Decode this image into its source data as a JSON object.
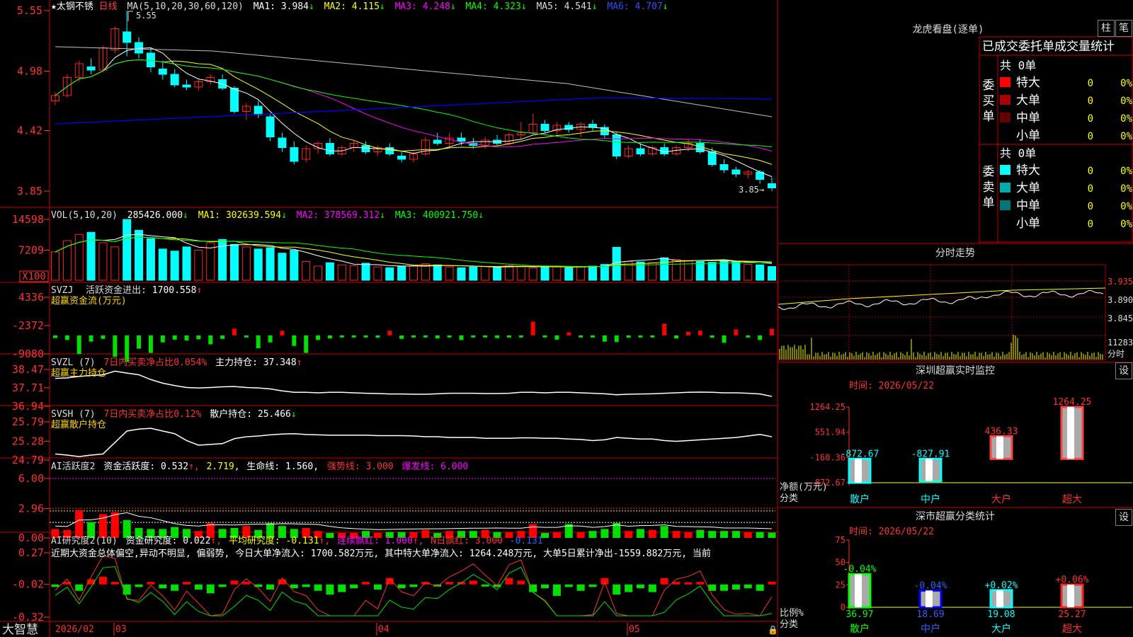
{
  "stock": {
    "name": "★太钢不锈",
    "period": "日线"
  },
  "colors": {
    "up": "#ff2020",
    "down": "#00ffff",
    "ma1": "#ffffff",
    "ma2": "#ffff00",
    "ma3": "#ff00ff",
    "ma4": "#00ff00",
    "ma5": "#c0c0c0",
    "ma6": "#0000ff",
    "grid": "#aa0000",
    "axis": "#ff3030"
  },
  "price_panel": {
    "params": "MA(5,10,20,30,60,120)",
    "ma": [
      {
        "label": "MA1: 3.984",
        "arrow": "↓"
      },
      {
        "label": "MA2: 4.115",
        "arrow": "↓"
      },
      {
        "label": "MA3: 4.248",
        "arrow": "↓"
      },
      {
        "label": "MA4: 4.323",
        "arrow": "↓"
      },
      {
        "label": "MA5: 4.541",
        "arrow": "↓"
      },
      {
        "label": "MA6: 4.707",
        "arrow": "↓"
      }
    ],
    "ticks": [
      "5.55",
      "4.98",
      "4.42",
      "3.85"
    ],
    "high_label": "5.55",
    "low_label": "3.85→"
  },
  "vol_panel": {
    "title": "VOL(5,10,20)",
    "value": "285426.000",
    "value_arrow": "↓",
    "ma": [
      {
        "label": "MA1: 302639.594",
        "arrow": "↓"
      },
      {
        "label": "MA2: 378569.312",
        "arrow": "↓"
      },
      {
        "label": "MA3: 400921.750",
        "arrow": "↓"
      }
    ],
    "ticks": [
      "14598",
      "7209"
    ],
    "unit": "X100"
  },
  "svzj_panel": {
    "title": "SVZJ",
    "label": "活跃资金进出:",
    "value": "1700.558",
    "arrow": "↑",
    "subtitle": "超赢资金流(万元)",
    "ticks": [
      "4336",
      "-2372",
      "-9080"
    ]
  },
  "svzl_panel": {
    "title": "SVZL (7)",
    "label1": "7日内买卖净占比0.054%",
    "label2": "主力持仓: 37.348",
    "arrow": "↑",
    "subtitle": "超赢主力持仓",
    "ticks": [
      "38.47",
      "37.71",
      "36.94"
    ]
  },
  "svsh_panel": {
    "title": "SVSH (7)",
    "label1": "7日内买卖净占比0.12%",
    "label2": "散户持仓: 25.466",
    "arrow": "↓",
    "subtitle": "超赢散户持仓",
    "ticks": [
      "25.79",
      "25.28",
      "24.79"
    ]
  },
  "ai1_panel": {
    "title": "AI活跃度2",
    "l1": "资金活跃度: 0.532",
    "l2": "2.719",
    "l3": "生命线: 1.560",
    "l4": "强势线: 3.000",
    "l5": "爆发线: 6.000",
    "ticks": [
      "6.00",
      "2.96",
      "0.00"
    ]
  },
  "ai2_panel": {
    "title": "AI研究度2(10)",
    "l1": "资金研究度: 0.022",
    "l2": "平均研究度: -0.131",
    "l3": "连续飘红: 1.000",
    "l4": "N日飘红: 3.000",
    "l5": "-0.131",
    "text": "近期大资金总体偏空,异动不明显, 偏弱势, 今日大单净流入: 1700.582万元, 其中特大单净流入: 1264.248万元, 大单5日累计净出-1559.882万元, 当前",
    "ticks": [
      "0.27",
      "-0.02",
      "-0.32"
    ]
  },
  "bottom": {
    "brand": "大智慧",
    "dates": [
      "2026/02",
      "03",
      "04",
      "05"
    ]
  },
  "right": {
    "lhb_title": "龙虎看盘(逐单)",
    "btn_zhu": "柱",
    "btn_bi": "笔",
    "stat_title": "已成交委托单成交量统计",
    "buy": {
      "label": "委买单",
      "count": "共 0单",
      "rows": [
        {
          "name": "特大",
          "v": "0",
          "p": "0%",
          "c": "#ff0000"
        },
        {
          "name": "大单",
          "v": "0",
          "p": "0%",
          "c": "#aa0000"
        },
        {
          "name": "中单",
          "v": "0",
          "p": "0%",
          "c": "#660000"
        },
        {
          "name": "小单",
          "v": "0",
          "p": "0%",
          "c": ""
        }
      ]
    },
    "sell": {
      "label": "委卖单",
      "count": "共 0单",
      "rows": [
        {
          "name": "特大",
          "v": "0",
          "p": "0%",
          "c": "#00ffff"
        },
        {
          "name": "大单",
          "v": "0",
          "p": "0%",
          "c": "#00aaaa"
        },
        {
          "name": "中单",
          "v": "0",
          "p": "0%",
          "c": "#007777"
        },
        {
          "name": "小单",
          "v": "0",
          "p": "0%",
          "c": ""
        }
      ]
    },
    "fs_title": "分时走势",
    "fs_ticks": [
      "3.935",
      "3.890",
      "3.845"
    ],
    "fs_vol_ticks": [
      "11283",
      "分时"
    ],
    "sz_title": "深圳超赢实时监控",
    "sz_time": "时间: 2026/05/22",
    "btn_set": "设",
    "sz_ticks": [
      "1264.25",
      "551.94",
      "-160.36",
      "-872.67"
    ],
    "sz_axis_label1": "净额(万元)",
    "sz_axis_label2": "分类",
    "sz_bars": [
      {
        "cat": "散户",
        "value": -872.67,
        "label": "-872.67"
      },
      {
        "cat": "中户",
        "value": -827.91,
        "label": "-827.91"
      },
      {
        "cat": "大户",
        "value": 436.33,
        "label": "436.33"
      },
      {
        "cat": "超大",
        "value": 1264.25,
        "label": "1264.25"
      }
    ],
    "cls_title": "深市超赢分类统计",
    "cls_time": "时间: 2026/05/22",
    "cls_ticks": [
      "75",
      "50",
      "25",
      "0"
    ],
    "cls_axis_label1": "比例%",
    "cls_axis_label2": "分类",
    "cls_bars": [
      {
        "cat": "散户",
        "value": 36.97,
        "label": "36.97",
        "chg": "-0.04%"
      },
      {
        "cat": "中户",
        "value": 18.69,
        "label": "18.69",
        "chg": "-0.04%"
      },
      {
        "cat": "大户",
        "value": 19.08,
        "label": "19.08",
        "chg": "+0.02%"
      },
      {
        "cat": "超大",
        "value": 25.27,
        "label": "25.27",
        "chg": "+0.06%"
      }
    ]
  },
  "chart_data": [
    {
      "type": "candlestick",
      "title": "★太钢不锈 日线",
      "ylim": [
        3.85,
        5.55
      ],
      "x": [
        "2026-02-23",
        "2026-02-24",
        "2026-02-25",
        "2026-02-26",
        "2026-02-27",
        "2026-03-02",
        "2026-03-03",
        "2026-03-04",
        "2026-03-05",
        "2026-03-06",
        "2026-03-09",
        "2026-03-10",
        "2026-03-11",
        "2026-03-12",
        "2026-03-13",
        "2026-03-16",
        "2026-03-17",
        "2026-03-18",
        "2026-03-19",
        "2026-03-20",
        "2026-03-23",
        "2026-03-24",
        "2026-03-25",
        "2026-03-26",
        "2026-03-27",
        "2026-03-30",
        "2026-03-31",
        "2026-04-01",
        "2026-04-02",
        "2026-04-03",
        "2026-04-07",
        "2026-04-08",
        "2026-04-09",
        "2026-04-10",
        "2026-04-13",
        "2026-04-14",
        "2026-04-15",
        "2026-04-16",
        "2026-04-17",
        "2026-04-20",
        "2026-04-21",
        "2026-04-22",
        "2026-04-23",
        "2026-04-24",
        "2026-04-27",
        "2026-04-28",
        "2026-04-29",
        "2026-04-30",
        "2026-05-06",
        "2026-05-07",
        "2026-05-08",
        "2026-05-11",
        "2026-05-12",
        "2026-05-13",
        "2026-05-14",
        "2026-05-15",
        "2026-05-18",
        "2026-05-19",
        "2026-05-20",
        "2026-05-21",
        "2026-05-22"
      ],
      "ohlc": [
        [
          4.7,
          4.78,
          4.66,
          4.75
        ],
        [
          4.75,
          4.95,
          4.73,
          4.92
        ],
        [
          4.92,
          5.08,
          4.88,
          5.05
        ],
        [
          5.02,
          5.1,
          4.95,
          4.99
        ],
        [
          4.99,
          5.22,
          4.97,
          5.2
        ],
        [
          5.18,
          5.4,
          5.15,
          5.38
        ],
        [
          5.35,
          5.55,
          5.12,
          5.25
        ],
        [
          5.25,
          5.3,
          5.1,
          5.15
        ],
        [
          5.15,
          5.2,
          4.97,
          5.02
        ],
        [
          5.0,
          5.08,
          4.9,
          4.95
        ],
        [
          4.95,
          5.0,
          4.83,
          4.85
        ],
        [
          4.85,
          4.9,
          4.8,
          4.83
        ],
        [
          4.83,
          4.9,
          4.8,
          4.88
        ],
        [
          4.88,
          4.95,
          4.85,
          4.92
        ],
        [
          4.9,
          4.95,
          4.8,
          4.82
        ],
        [
          4.82,
          4.84,
          4.58,
          4.6
        ],
        [
          4.6,
          4.68,
          4.52,
          4.65
        ],
        [
          4.65,
          4.7,
          4.54,
          4.57
        ],
        [
          4.55,
          4.58,
          4.32,
          4.36
        ],
        [
          4.35,
          4.4,
          4.22,
          4.26
        ],
        [
          4.26,
          4.32,
          4.1,
          4.13
        ],
        [
          4.15,
          4.28,
          4.12,
          4.25
        ],
        [
          4.25,
          4.32,
          4.2,
          4.3
        ],
        [
          4.3,
          4.35,
          4.18,
          4.2
        ],
        [
          4.2,
          4.28,
          4.18,
          4.26
        ],
        [
          4.26,
          4.33,
          4.22,
          4.3
        ],
        [
          4.28,
          4.32,
          4.2,
          4.22
        ],
        [
          4.22,
          4.28,
          4.18,
          4.26
        ],
        [
          4.26,
          4.3,
          4.18,
          4.2
        ],
        [
          4.18,
          4.22,
          4.12,
          4.15
        ],
        [
          4.15,
          4.22,
          4.12,
          4.2
        ],
        [
          4.2,
          4.36,
          4.18,
          4.33
        ],
        [
          4.33,
          4.4,
          4.28,
          4.3
        ],
        [
          4.3,
          4.4,
          4.26,
          4.35
        ],
        [
          4.35,
          4.4,
          4.28,
          4.32
        ],
        [
          4.3,
          4.35,
          4.25,
          4.28
        ],
        [
          4.28,
          4.36,
          4.25,
          4.33
        ],
        [
          4.33,
          4.38,
          4.28,
          4.3
        ],
        [
          4.3,
          4.4,
          4.28,
          4.38
        ],
        [
          4.38,
          4.5,
          4.34,
          4.4
        ],
        [
          4.4,
          4.58,
          4.38,
          4.48
        ],
        [
          4.48,
          4.52,
          4.4,
          4.42
        ],
        [
          4.42,
          4.5,
          4.38,
          4.47
        ],
        [
          4.47,
          4.5,
          4.4,
          4.43
        ],
        [
          4.43,
          4.5,
          4.36,
          4.48
        ],
        [
          4.48,
          4.52,
          4.42,
          4.45
        ],
        [
          4.45,
          4.48,
          4.35,
          4.38
        ],
        [
          4.38,
          4.4,
          4.15,
          4.18
        ],
        [
          4.18,
          4.28,
          4.16,
          4.25
        ],
        [
          4.25,
          4.3,
          4.18,
          4.2
        ],
        [
          4.2,
          4.28,
          4.18,
          4.26
        ],
        [
          4.26,
          4.3,
          4.18,
          4.2
        ],
        [
          4.2,
          4.28,
          4.18,
          4.26
        ],
        [
          4.26,
          4.34,
          4.22,
          4.3
        ],
        [
          4.3,
          4.34,
          4.2,
          4.22
        ],
        [
          4.22,
          4.26,
          4.08,
          4.1
        ],
        [
          4.1,
          4.15,
          4.02,
          4.05
        ],
        [
          4.05,
          4.08,
          3.98,
          4.01
        ],
        [
          4.01,
          4.05,
          3.97,
          4.03
        ],
        [
          4.03,
          4.05,
          3.92,
          3.96
        ],
        [
          3.92,
          3.98,
          3.85,
          3.88
        ]
      ],
      "series": [
        {
          "name": "MA1"
        },
        {
          "name": "MA2"
        },
        {
          "name": "MA3"
        },
        {
          "name": "MA4"
        },
        {
          "name": "MA5"
        },
        {
          "name": "MA6"
        }
      ]
    },
    {
      "type": "bar",
      "title": "VOL(5,10,20)",
      "ylabel": "X100",
      "ylim": [
        0,
        14598
      ],
      "values": [
        6800,
        9500,
        11000,
        11500,
        9000,
        8000,
        14598,
        12000,
        10000,
        7500,
        7000,
        8000,
        7200,
        9000,
        9800,
        8600,
        8000,
        7500,
        7800,
        6500,
        7200,
        4500,
        3400,
        4200,
        3700,
        3500,
        4100,
        3200,
        3000,
        3300,
        3500,
        4000,
        3700,
        3200,
        3000,
        3200,
        3300,
        3100,
        3500,
        3300,
        3000,
        3400,
        3200,
        3000,
        3300,
        3400,
        3800,
        7900,
        4500,
        4400,
        4200,
        5400,
        5000,
        4600,
        4500,
        4300,
        4800,
        4600,
        3800,
        3700,
        3300
      ]
    },
    {
      "type": "bar",
      "title": "SVZJ 超赢资金流(万元)",
      "ylim": [
        -9080,
        4336
      ],
      "values": [
        -700,
        -1200,
        -4800,
        -1600,
        -900,
        -5500,
        -6800,
        -3400,
        -4500,
        -1800,
        -1100,
        -1300,
        -1000,
        -2300,
        -900,
        1700,
        -500,
        -3300,
        -1800,
        1200,
        -2700,
        -4500,
        -1200,
        -800,
        -100,
        -200,
        -400,
        -600,
        1200,
        -900,
        -200,
        -300,
        -800,
        -100,
        -1200,
        -200,
        -300,
        -700,
        -500,
        -400,
        3500,
        -300,
        -1100,
        800,
        -200,
        -500,
        -1600,
        -1700,
        -600,
        -300,
        -400,
        3000,
        -800,
        900,
        1200,
        -600,
        -1900,
        1500,
        -100,
        -1200,
        1700.558
      ]
    },
    {
      "type": "line",
      "title": "SVZL 超赢主力持仓",
      "ylim": [
        36.94,
        38.47
      ],
      "values": [
        38.1,
        38.12,
        38.18,
        38.22,
        38.25,
        38.4,
        38.32,
        38.25,
        38.05,
        37.9,
        37.8,
        37.72,
        37.7,
        37.72,
        37.75,
        37.76,
        37.72,
        37.7,
        37.66,
        37.58,
        37.52,
        37.52,
        37.5,
        37.52,
        37.52,
        37.5,
        37.48,
        37.47,
        37.45,
        37.45,
        37.44,
        37.44,
        37.46,
        37.48,
        37.48,
        37.48,
        37.47,
        37.47,
        37.48,
        37.52,
        37.52,
        37.5,
        37.52,
        37.52,
        37.5,
        37.48,
        37.46,
        37.42,
        37.44,
        37.45,
        37.46,
        37.48,
        37.5,
        37.52,
        37.53,
        37.52,
        37.5,
        37.5,
        37.48,
        37.45,
        37.35
      ]
    },
    {
      "type": "line",
      "title": "SVSH 超赢散户持仓",
      "ylim": [
        24.79,
        25.79
      ],
      "values": [
        24.95,
        24.92,
        24.88,
        24.92,
        24.95,
        25.25,
        25.55,
        25.6,
        25.62,
        25.55,
        25.48,
        25.3,
        25.18,
        25.2,
        25.22,
        25.35,
        25.4,
        25.42,
        25.45,
        25.47,
        25.48,
        25.46,
        25.45,
        25.44,
        25.44,
        25.44,
        25.44,
        25.43,
        25.43,
        25.43,
        25.42,
        25.4,
        25.4,
        25.38,
        25.38,
        25.38,
        25.36,
        25.36,
        25.36,
        25.37,
        25.37,
        25.36,
        25.36,
        25.34,
        25.33,
        25.3,
        25.32,
        25.38,
        25.36,
        25.34,
        25.34,
        25.3,
        25.28,
        25.3,
        25.32,
        25.34,
        25.36,
        25.38,
        25.42,
        25.46,
        25.4
      ]
    },
    {
      "type": "bar",
      "title": "AI活跃度2",
      "ylim": [
        0,
        6.0
      ],
      "values": [
        0.9,
        0.8,
        2.8,
        1.6,
        2.4,
        2.6,
        1.8,
        1.0,
        0.9,
        0.9,
        1.1,
        0.9,
        0.7,
        1.5,
        0.9,
        1.0,
        1.2,
        0.8,
        1.5,
        1.2,
        0.9,
        1.0,
        0.7,
        0.5,
        0.5,
        0.5,
        0.7,
        0.5,
        0.6,
        0.6,
        0.6,
        0.8,
        0.5,
        0.7,
        0.7,
        0.7,
        0.8,
        0.6,
        0.6,
        0.7,
        1.4,
        0.5,
        0.6,
        1.4,
        0.6,
        0.7,
        0.9,
        1.5,
        0.7,
        0.9,
        0.8,
        1.2,
        0.7,
        0.6,
        0.8,
        0.7,
        0.7,
        0.7,
        0.6,
        0.6,
        0.532
      ]
    },
    {
      "type": "bar",
      "title": "AI研究度2(10)",
      "ylim": [
        -0.32,
        0.27
      ],
      "values": [
        -0.02,
        0.02,
        -0.05,
        0.04,
        0.06,
        0.02,
        -0.08,
        -0.02,
        0.02,
        -0.03,
        -0.05,
        0.02,
        -0.04,
        -0.07,
        -0.02,
        0.03,
        0.02,
        -0.02,
        -0.04,
        0.04,
        -0.03,
        -0.02,
        -0.05,
        -0.08,
        -0.06,
        -0.03,
        0.02,
        -0.04,
        0.05,
        -0.03,
        -0.02,
        0.02,
        -0.01,
        0.02,
        0.02,
        0.03,
        -0.01,
        -0.02,
        0.05,
        0.03,
        -0.06,
        -0.03,
        -0.09,
        -0.02,
        -0.05,
        -0.02,
        0.05,
        -0.08,
        -0.06,
        -0.03,
        -0.06,
        0.05,
        0.02,
        0.01,
        0.02,
        -0.05,
        -0.05,
        -0.04,
        -0.03,
        -0.05,
        0.022
      ]
    }
  ]
}
